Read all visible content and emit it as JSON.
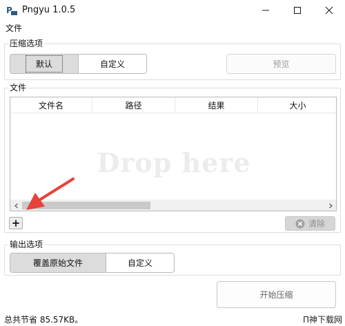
{
  "window": {
    "title": "Pngyu 1.0.5",
    "minimize_icon": "minimize-icon",
    "maximize_icon": "maximize-icon",
    "close_icon": "close-icon"
  },
  "menu": {
    "file": "文件"
  },
  "compression": {
    "group_title": "压缩选项",
    "default_label": "默认",
    "custom_label": "自定义",
    "preview_label": "预览"
  },
  "files": {
    "group_title": "文件",
    "columns": [
      "文件名",
      "路径",
      "结果",
      "大小"
    ],
    "drop_text": "Drop here",
    "add_label": "+",
    "clear_label": "清除"
  },
  "output": {
    "group_title": "输出选项",
    "overwrite_label": "覆盖原始文件",
    "custom_label": "自定义"
  },
  "actions": {
    "start_label": "开始压缩"
  },
  "status": {
    "saved_text": "总共节省 85.57KB。"
  },
  "watermark": {
    "text": "Π神下载网"
  },
  "colors": {
    "arrow": "#e8413a",
    "accent_text": "#111111"
  }
}
